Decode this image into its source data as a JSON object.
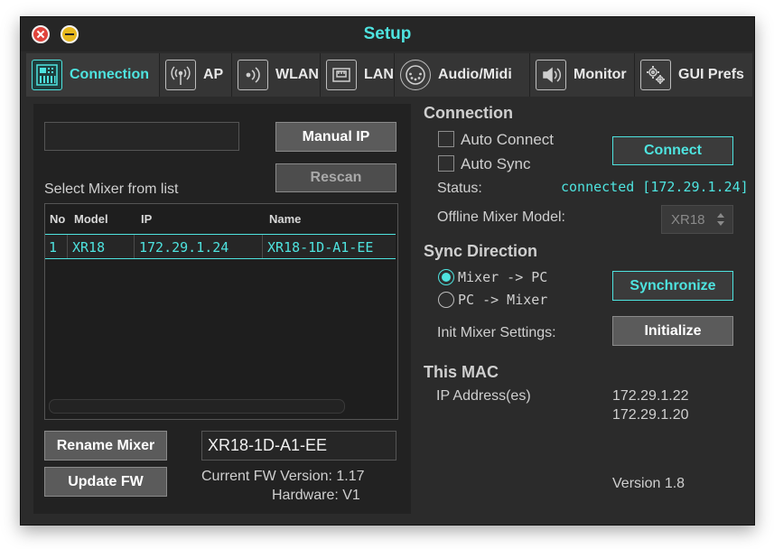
{
  "window": {
    "title": "Setup"
  },
  "tabs": [
    {
      "label": "Connection",
      "icon": "mixer-icon",
      "active": true
    },
    {
      "label": "AP",
      "icon": "antenna-icon"
    },
    {
      "label": "WLAN",
      "icon": "wifi-icon"
    },
    {
      "label": "LAN",
      "icon": "ethernet-icon"
    },
    {
      "label": "Audio/Midi",
      "icon": "midi-icon"
    },
    {
      "label": "Monitor",
      "icon": "speaker-icon"
    },
    {
      "label": "GUI Prefs",
      "icon": "gears-icon"
    }
  ],
  "left": {
    "ip_input_value": "",
    "manual_ip_label": "Manual IP",
    "rescan_label": "Rescan",
    "select_mixer_label": "Select Mixer from list",
    "table": {
      "headers": [
        "No",
        "Model",
        "IP",
        "Name"
      ],
      "rows": [
        {
          "no": "1",
          "model": "XR18",
          "ip": "172.29.1.24",
          "name": "XR18-1D-A1-EE"
        }
      ]
    },
    "rename_label": "Rename Mixer",
    "update_fw_label": "Update FW",
    "name_value": "XR18-1D-A1-EE",
    "fw_version": "Current FW Version: 1.17",
    "hardware": "Hardware: V1"
  },
  "right": {
    "connection_heading": "Connection",
    "auto_connect": "Auto Connect",
    "auto_sync": "Auto Sync",
    "connect_label": "Connect",
    "status_label": "Status:",
    "status_value": "connected [172.29.1.24]",
    "offline_label": "Offline Mixer Model:",
    "offline_value": "XR18",
    "sync_heading": "Sync Direction",
    "mixer_to_pc": "Mixer -> PC",
    "pc_to_mixer": "PC -> Mixer",
    "synchronize_label": "Synchronize",
    "init_label": "Init Mixer Settings:",
    "initialize_label": "Initialize",
    "mac_heading": "This MAC",
    "ip_label": "IP Address(es)",
    "ip_addresses": [
      "172.29.1.22",
      "172.29.1.20"
    ],
    "version": "Version 1.8"
  },
  "colors": {
    "accent": "#4ee3df",
    "window_bg": "#2b2b2b",
    "panel_bg": "#222222"
  }
}
